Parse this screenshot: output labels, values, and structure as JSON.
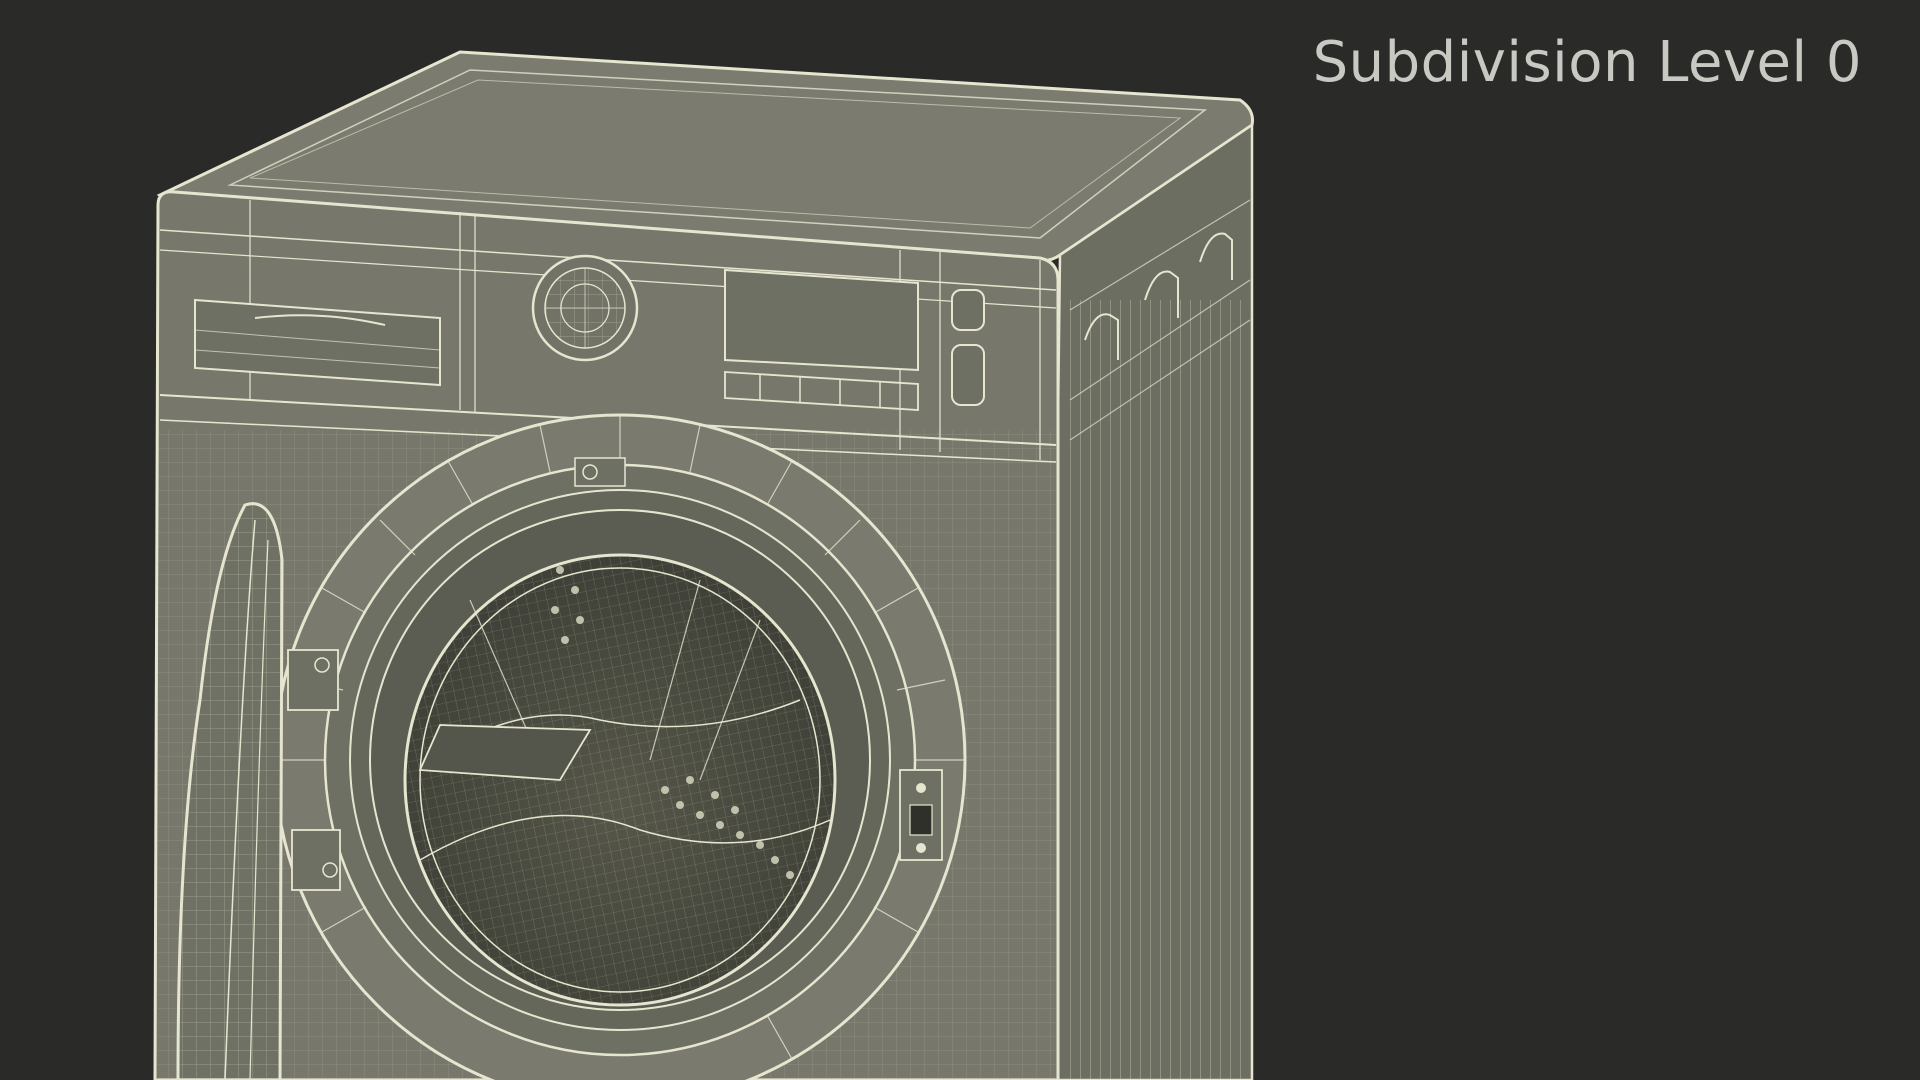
{
  "overlay": {
    "label": "Subdivision Level 0"
  },
  "scene": {
    "subject": "washing-machine-wireframe",
    "colors": {
      "background": "#2a2a28",
      "surface": "#76776a",
      "surface_dark": "#5f6055",
      "wire": "#e6e6d0",
      "interior": "#46473f"
    }
  }
}
